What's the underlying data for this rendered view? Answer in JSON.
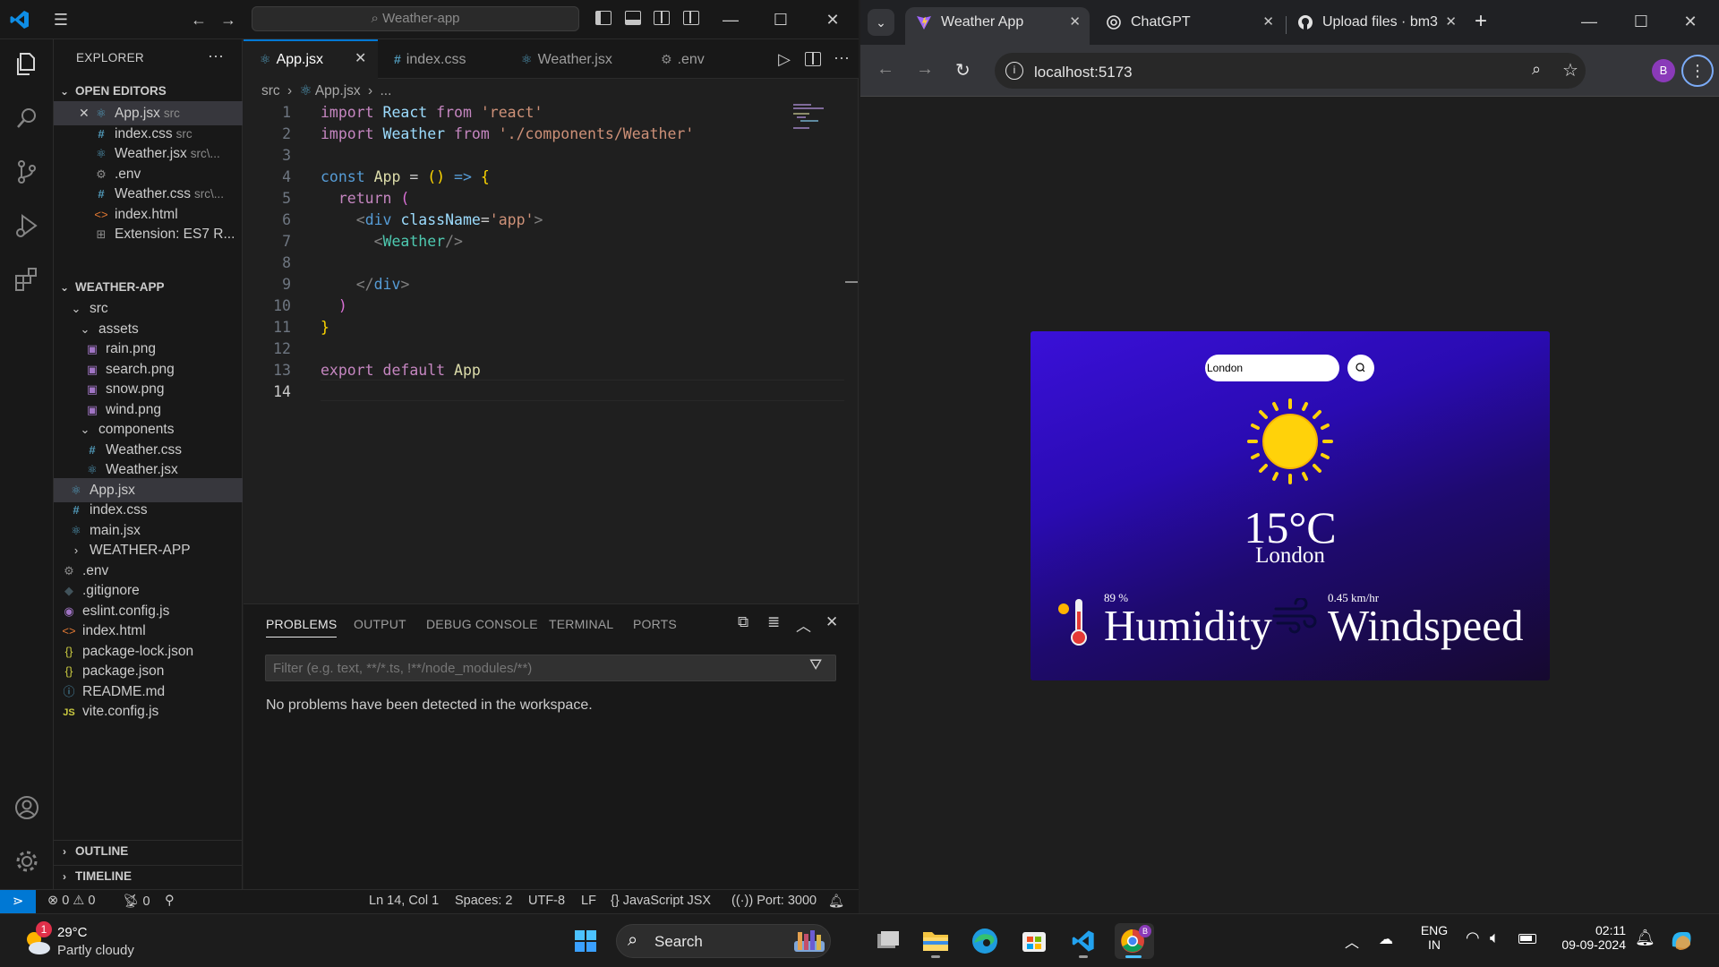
{
  "vscode": {
    "search": "Weather-app",
    "explorer_title": "EXPLORER",
    "open_editors_label": "OPEN EDITORS",
    "open_editors": [
      {
        "name": "App.jsx",
        "sub": "src",
        "icon": "react-icon"
      },
      {
        "name": "index.css",
        "sub": "src",
        "icon": "css-icon"
      },
      {
        "name": "Weather.jsx",
        "sub": "src\\...",
        "icon": "react-icon"
      },
      {
        "name": ".env",
        "sub": "",
        "icon": "gear-icon"
      },
      {
        "name": "Weather.css",
        "sub": "src\\...",
        "icon": "css-icon"
      },
      {
        "name": "index.html",
        "sub": "",
        "icon": "html-icon"
      },
      {
        "name": "Extension: ES7 R...",
        "sub": "",
        "icon": "extension-icon"
      }
    ],
    "project_label": "WEATHER-APP",
    "tree": [
      {
        "name": "src",
        "icon": "chevron-down-icon"
      },
      {
        "name": "assets",
        "icon": "chevron-down-icon"
      },
      {
        "name": "rain.png",
        "icon": "image-icon"
      },
      {
        "name": "search.png",
        "icon": "image-icon"
      },
      {
        "name": "snow.png",
        "icon": "image-icon"
      },
      {
        "name": "wind.png",
        "icon": "image-icon"
      },
      {
        "name": "components",
        "icon": "chevron-down-icon"
      },
      {
        "name": "Weather.css",
        "icon": "css-icon"
      },
      {
        "name": "Weather.jsx",
        "icon": "react-icon"
      },
      {
        "name": "App.jsx",
        "icon": "react-icon"
      },
      {
        "name": "index.css",
        "icon": "css-icon"
      },
      {
        "name": "main.jsx",
        "icon": "react-icon"
      },
      {
        "name": "WEATHER-APP",
        "icon": "chevron-right-icon"
      },
      {
        "name": ".env",
        "icon": "gear-icon"
      },
      {
        "name": ".gitignore",
        "icon": "git-icon"
      },
      {
        "name": "eslint.config.js",
        "icon": "eslint-icon"
      },
      {
        "name": "index.html",
        "icon": "html-icon"
      },
      {
        "name": "package-lock.json",
        "icon": "json-icon"
      },
      {
        "name": "package.json",
        "icon": "json-icon"
      },
      {
        "name": "README.md",
        "icon": "info-icon"
      },
      {
        "name": "vite.config.js",
        "icon": "js-icon"
      }
    ],
    "outline_label": "OUTLINE",
    "timeline_label": "TIMELINE",
    "tabs": [
      {
        "label": "App.jsx",
        "icon": "react-icon"
      },
      {
        "label": "index.css",
        "icon": "css-icon"
      },
      {
        "label": "Weather.jsx",
        "icon": "react-icon"
      },
      {
        "label": ".env",
        "icon": "gear-icon"
      }
    ],
    "breadcrumb": {
      "folder": "src",
      "file": "App.jsx",
      "rest": "..."
    },
    "code_lines": [
      "import React from 'react'",
      "import Weather from './components/Weather'",
      "",
      "const App = () => {",
      "  return (",
      "    <div className='app'>",
      "      <Weather/>",
      "",
      "    </div>",
      "  )",
      "}",
      "",
      "export default App",
      ""
    ],
    "line_numbers": [
      "1",
      "2",
      "3",
      "4",
      "5",
      "6",
      "7",
      "8",
      "9",
      "10",
      "11",
      "12",
      "13",
      "14"
    ],
    "panel": {
      "tabs": [
        "PROBLEMS",
        "OUTPUT",
        "DEBUG CONSOLE",
        "TERMINAL",
        "PORTS"
      ],
      "filter_placeholder": "Filter (e.g. text, **/*.ts, !**/node_modules/**)",
      "message": "No problems have been detected in the workspace."
    },
    "status": {
      "errors": "0",
      "warnings": "0",
      "ports": "0",
      "position": "Ln 14, Col 1",
      "spaces": "Spaces: 2",
      "encoding": "UTF-8",
      "eol": "LF",
      "language": "JavaScript JSX",
      "port": "Port: 3000"
    }
  },
  "chrome": {
    "tabs": [
      {
        "label": "Weather App",
        "icon": "vite-icon"
      },
      {
        "label": "ChatGPT",
        "icon": "chatgpt-icon"
      },
      {
        "label": "Upload files · bm3",
        "icon": "github-icon"
      }
    ],
    "url": "localhost:5173",
    "profile_initial": "B"
  },
  "weather": {
    "city_input": "London",
    "temperature": "15°C",
    "location": "London",
    "humidity_value": "89 %",
    "humidity_label": "Humidity",
    "wind_value": "0.45 km/hr",
    "wind_label": "Windspeed"
  },
  "taskbar": {
    "weather_temp": "29°C",
    "weather_desc": "Partly cloudy",
    "weather_badge": "1",
    "search_label": "Search",
    "lang_line1": "ENG",
    "lang_line2": "IN",
    "time": "02:11",
    "date": "09-09-2024"
  }
}
